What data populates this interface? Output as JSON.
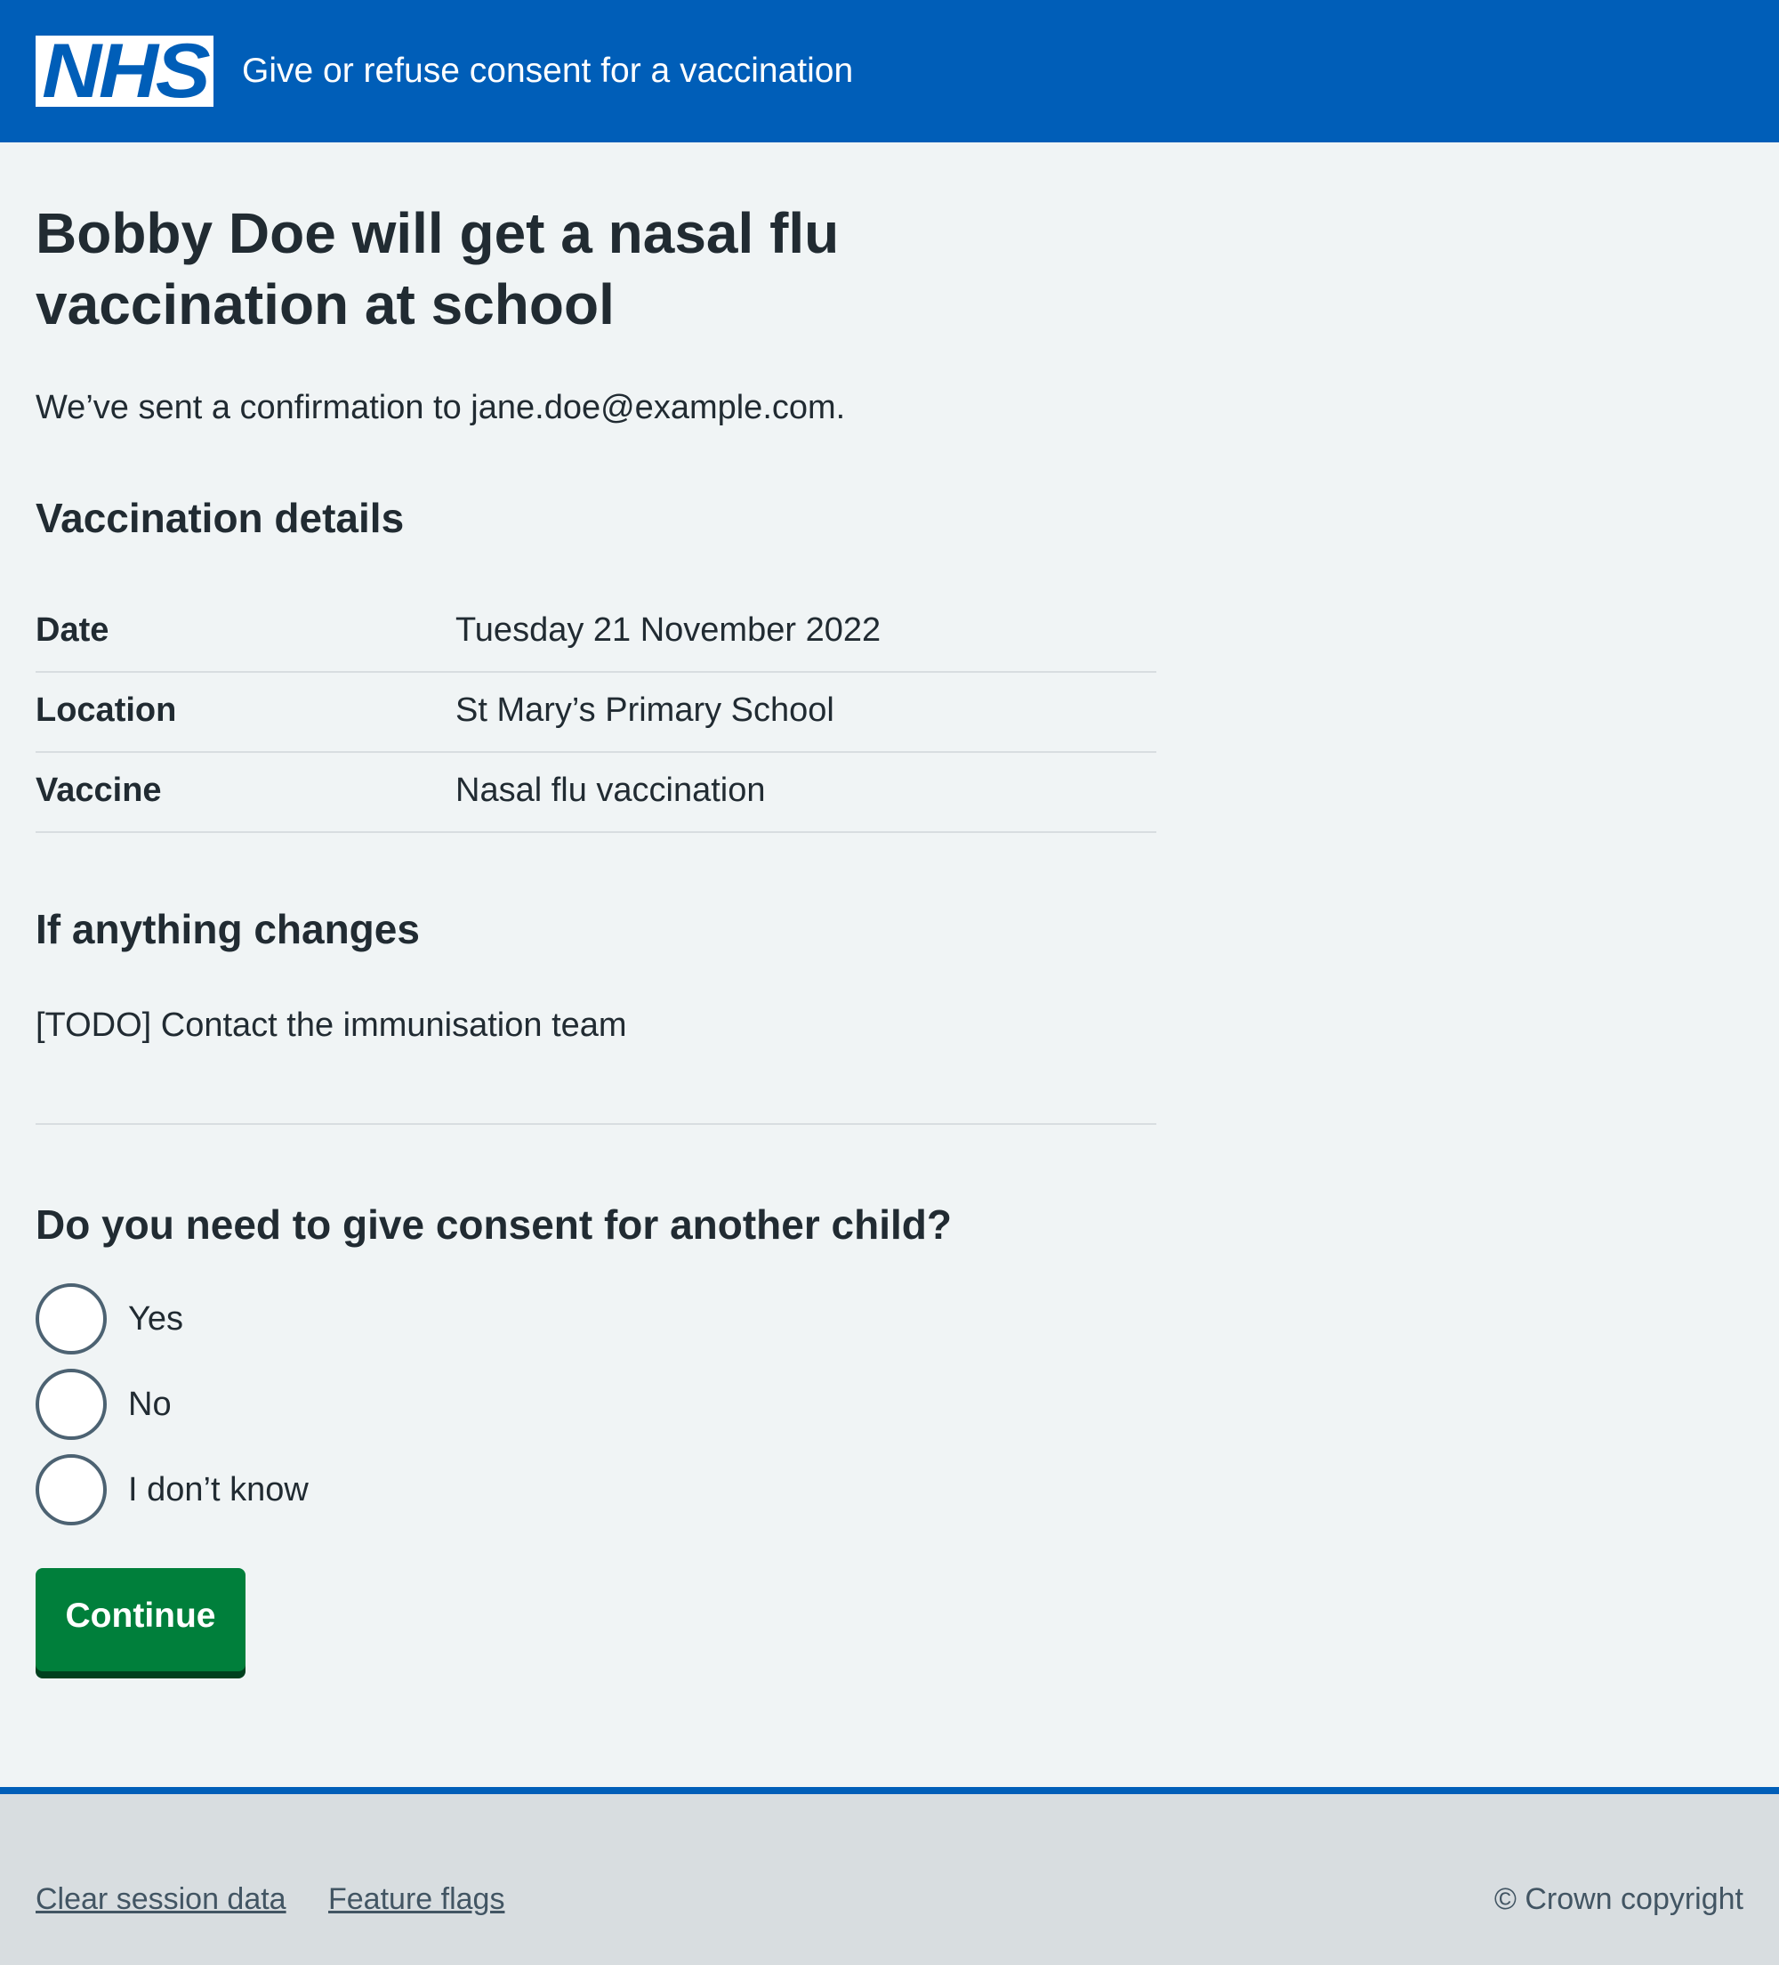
{
  "header": {
    "logo": "NHS",
    "service_name": "Give or refuse consent for a vaccination"
  },
  "main": {
    "title": "Bobby Doe will get a nasal flu vaccination at school",
    "confirmation": "We’ve sent a confirmation to jane.doe@example.com.",
    "details_heading": "Vaccination details",
    "details": [
      {
        "key": "Date",
        "value": "Tuesday 21 November 2022"
      },
      {
        "key": "Location",
        "value": "St Mary’s Primary School"
      },
      {
        "key": "Vaccine",
        "value": "Nasal flu vaccination"
      }
    ],
    "changes_heading": "If anything changes",
    "changes_text": "[TODO] Contact the immunisation team",
    "question": "Do you need to give consent for another child?",
    "options": [
      "Yes",
      "No",
      "I don’t know"
    ],
    "continue_label": "Continue"
  },
  "footer": {
    "links": [
      "Clear session data",
      "Feature flags"
    ],
    "copyright": "© Crown copyright"
  },
  "colors": {
    "brand_blue": "#005eb8",
    "background": "#f0f4f5",
    "button_green": "#007f3b",
    "text": "#212b32",
    "footer_bg": "#d8dde0"
  }
}
